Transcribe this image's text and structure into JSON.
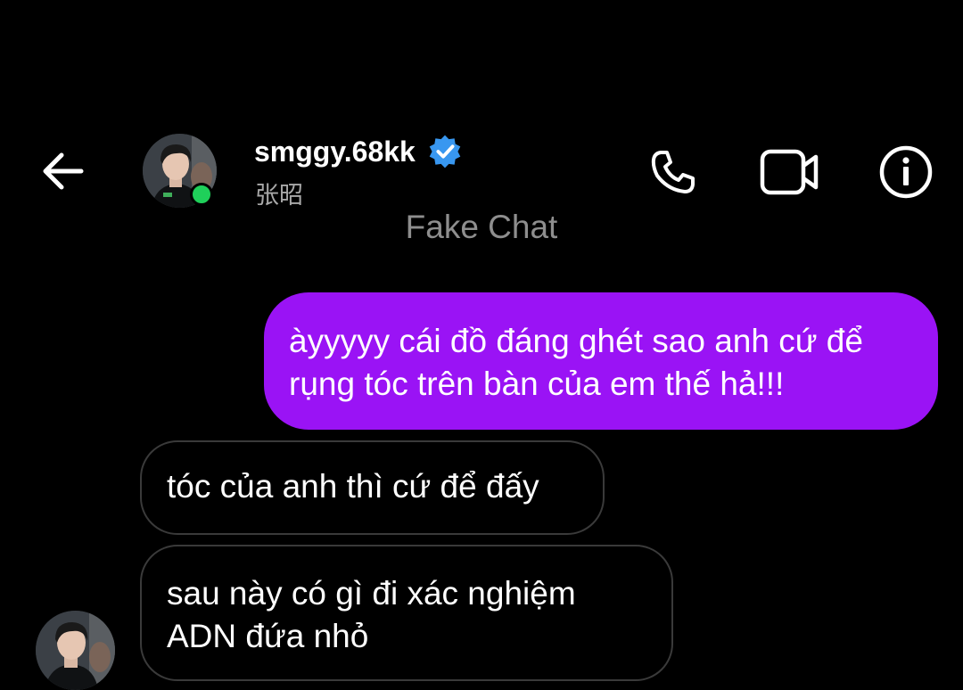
{
  "header": {
    "username": "smggy.68kk",
    "display_name": "张昭",
    "verified": true,
    "online": true,
    "online_color": "#1fd05a",
    "verified_color": "#3897f0",
    "icons": {
      "back": "back-arrow-icon",
      "phone": "phone-icon",
      "video": "video-camera-icon",
      "info": "info-icon"
    }
  },
  "chat_label": "Fake Chat",
  "messages": [
    {
      "direction": "sent",
      "lines": [
        "àyyyyy cái đồ đáng ghét sao anh cứ để",
        "rụng tóc trên bàn của em thế hả!!!"
      ],
      "bubble_color": "#9a13f5"
    },
    {
      "direction": "received",
      "lines": [
        "tóc của anh thì cứ để đấy"
      ]
    },
    {
      "direction": "received",
      "lines": [
        "sau này có gì đi xác nghiệm",
        "ADN đứa nhỏ"
      ]
    }
  ]
}
